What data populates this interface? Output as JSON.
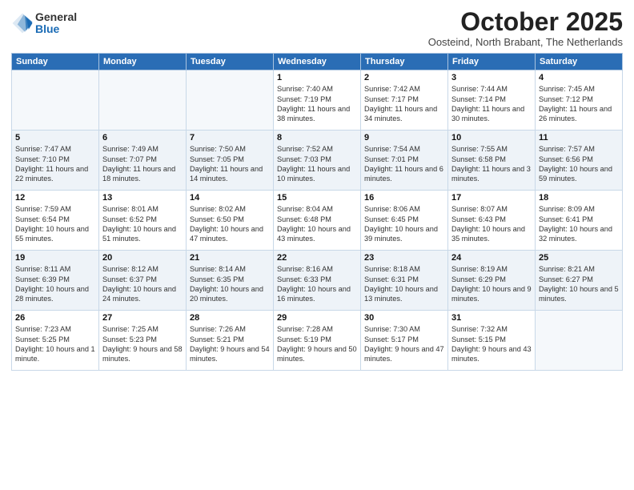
{
  "logo": {
    "general": "General",
    "blue": "Blue"
  },
  "header": {
    "month": "October 2025",
    "location": "Oosteind, North Brabant, The Netherlands"
  },
  "weekdays": [
    "Sunday",
    "Monday",
    "Tuesday",
    "Wednesday",
    "Thursday",
    "Friday",
    "Saturday"
  ],
  "weeks": [
    [
      {
        "day": "",
        "info": ""
      },
      {
        "day": "",
        "info": ""
      },
      {
        "day": "",
        "info": ""
      },
      {
        "day": "1",
        "info": "Sunrise: 7:40 AM\nSunset: 7:19 PM\nDaylight: 11 hours\nand 38 minutes."
      },
      {
        "day": "2",
        "info": "Sunrise: 7:42 AM\nSunset: 7:17 PM\nDaylight: 11 hours\nand 34 minutes."
      },
      {
        "day": "3",
        "info": "Sunrise: 7:44 AM\nSunset: 7:14 PM\nDaylight: 11 hours\nand 30 minutes."
      },
      {
        "day": "4",
        "info": "Sunrise: 7:45 AM\nSunset: 7:12 PM\nDaylight: 11 hours\nand 26 minutes."
      }
    ],
    [
      {
        "day": "5",
        "info": "Sunrise: 7:47 AM\nSunset: 7:10 PM\nDaylight: 11 hours\nand 22 minutes."
      },
      {
        "day": "6",
        "info": "Sunrise: 7:49 AM\nSunset: 7:07 PM\nDaylight: 11 hours\nand 18 minutes."
      },
      {
        "day": "7",
        "info": "Sunrise: 7:50 AM\nSunset: 7:05 PM\nDaylight: 11 hours\nand 14 minutes."
      },
      {
        "day": "8",
        "info": "Sunrise: 7:52 AM\nSunset: 7:03 PM\nDaylight: 11 hours\nand 10 minutes."
      },
      {
        "day": "9",
        "info": "Sunrise: 7:54 AM\nSunset: 7:01 PM\nDaylight: 11 hours\nand 6 minutes."
      },
      {
        "day": "10",
        "info": "Sunrise: 7:55 AM\nSunset: 6:58 PM\nDaylight: 11 hours\nand 3 minutes."
      },
      {
        "day": "11",
        "info": "Sunrise: 7:57 AM\nSunset: 6:56 PM\nDaylight: 10 hours\nand 59 minutes."
      }
    ],
    [
      {
        "day": "12",
        "info": "Sunrise: 7:59 AM\nSunset: 6:54 PM\nDaylight: 10 hours\nand 55 minutes."
      },
      {
        "day": "13",
        "info": "Sunrise: 8:01 AM\nSunset: 6:52 PM\nDaylight: 10 hours\nand 51 minutes."
      },
      {
        "day": "14",
        "info": "Sunrise: 8:02 AM\nSunset: 6:50 PM\nDaylight: 10 hours\nand 47 minutes."
      },
      {
        "day": "15",
        "info": "Sunrise: 8:04 AM\nSunset: 6:48 PM\nDaylight: 10 hours\nand 43 minutes."
      },
      {
        "day": "16",
        "info": "Sunrise: 8:06 AM\nSunset: 6:45 PM\nDaylight: 10 hours\nand 39 minutes."
      },
      {
        "day": "17",
        "info": "Sunrise: 8:07 AM\nSunset: 6:43 PM\nDaylight: 10 hours\nand 35 minutes."
      },
      {
        "day": "18",
        "info": "Sunrise: 8:09 AM\nSunset: 6:41 PM\nDaylight: 10 hours\nand 32 minutes."
      }
    ],
    [
      {
        "day": "19",
        "info": "Sunrise: 8:11 AM\nSunset: 6:39 PM\nDaylight: 10 hours\nand 28 minutes."
      },
      {
        "day": "20",
        "info": "Sunrise: 8:12 AM\nSunset: 6:37 PM\nDaylight: 10 hours\nand 24 minutes."
      },
      {
        "day": "21",
        "info": "Sunrise: 8:14 AM\nSunset: 6:35 PM\nDaylight: 10 hours\nand 20 minutes."
      },
      {
        "day": "22",
        "info": "Sunrise: 8:16 AM\nSunset: 6:33 PM\nDaylight: 10 hours\nand 16 minutes."
      },
      {
        "day": "23",
        "info": "Sunrise: 8:18 AM\nSunset: 6:31 PM\nDaylight: 10 hours\nand 13 minutes."
      },
      {
        "day": "24",
        "info": "Sunrise: 8:19 AM\nSunset: 6:29 PM\nDaylight: 10 hours\nand 9 minutes."
      },
      {
        "day": "25",
        "info": "Sunrise: 8:21 AM\nSunset: 6:27 PM\nDaylight: 10 hours\nand 5 minutes."
      }
    ],
    [
      {
        "day": "26",
        "info": "Sunrise: 7:23 AM\nSunset: 5:25 PM\nDaylight: 10 hours\nand 1 minute."
      },
      {
        "day": "27",
        "info": "Sunrise: 7:25 AM\nSunset: 5:23 PM\nDaylight: 9 hours\nand 58 minutes."
      },
      {
        "day": "28",
        "info": "Sunrise: 7:26 AM\nSunset: 5:21 PM\nDaylight: 9 hours\nand 54 minutes."
      },
      {
        "day": "29",
        "info": "Sunrise: 7:28 AM\nSunset: 5:19 PM\nDaylight: 9 hours\nand 50 minutes."
      },
      {
        "day": "30",
        "info": "Sunrise: 7:30 AM\nSunset: 5:17 PM\nDaylight: 9 hours\nand 47 minutes."
      },
      {
        "day": "31",
        "info": "Sunrise: 7:32 AM\nSunset: 5:15 PM\nDaylight: 9 hours\nand 43 minutes."
      },
      {
        "day": "",
        "info": ""
      }
    ]
  ]
}
